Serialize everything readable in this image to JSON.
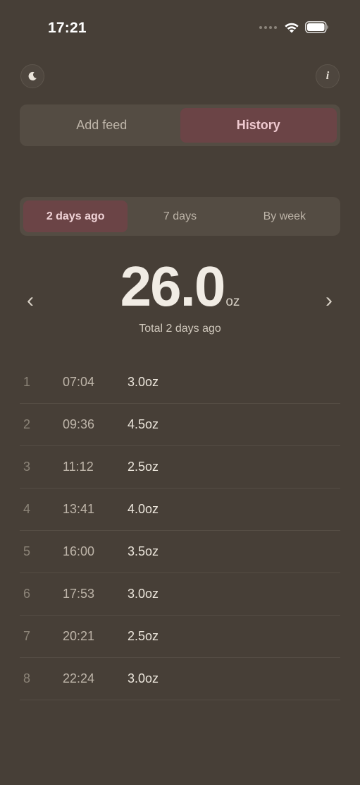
{
  "status_bar": {
    "time": "17:21",
    "icons": [
      "signal-dots-icon",
      "wifi-icon",
      "battery-icon"
    ]
  },
  "header": {
    "left_icon": "moon-icon",
    "right_icon": "info-icon",
    "info_glyph": "i"
  },
  "tabs": {
    "add_feed": "Add feed",
    "history": "History",
    "active": "History"
  },
  "range": {
    "options": [
      "2 days ago",
      "7 days",
      "By week"
    ],
    "active": "2 days ago"
  },
  "total": {
    "value": "26.0",
    "unit": "oz",
    "caption": "Total 2 days ago",
    "prev_glyph": "‹",
    "next_glyph": "›"
  },
  "feeds": [
    {
      "index": "1",
      "time": "07:04",
      "amount": "3.0oz"
    },
    {
      "index": "2",
      "time": "09:36",
      "amount": "4.5oz"
    },
    {
      "index": "3",
      "time": "11:12",
      "amount": "2.5oz"
    },
    {
      "index": "4",
      "time": "13:41",
      "amount": "4.0oz"
    },
    {
      "index": "5",
      "time": "16:00",
      "amount": "3.5oz"
    },
    {
      "index": "6",
      "time": "17:53",
      "amount": "3.0oz"
    },
    {
      "index": "7",
      "time": "20:21",
      "amount": "2.5oz"
    },
    {
      "index": "8",
      "time": "22:24",
      "amount": "3.0oz"
    }
  ],
  "colors": {
    "background": "#473f37",
    "segment_bg": "#544c43",
    "accent": "#6b4446",
    "accent_text": "#efc9cf"
  }
}
